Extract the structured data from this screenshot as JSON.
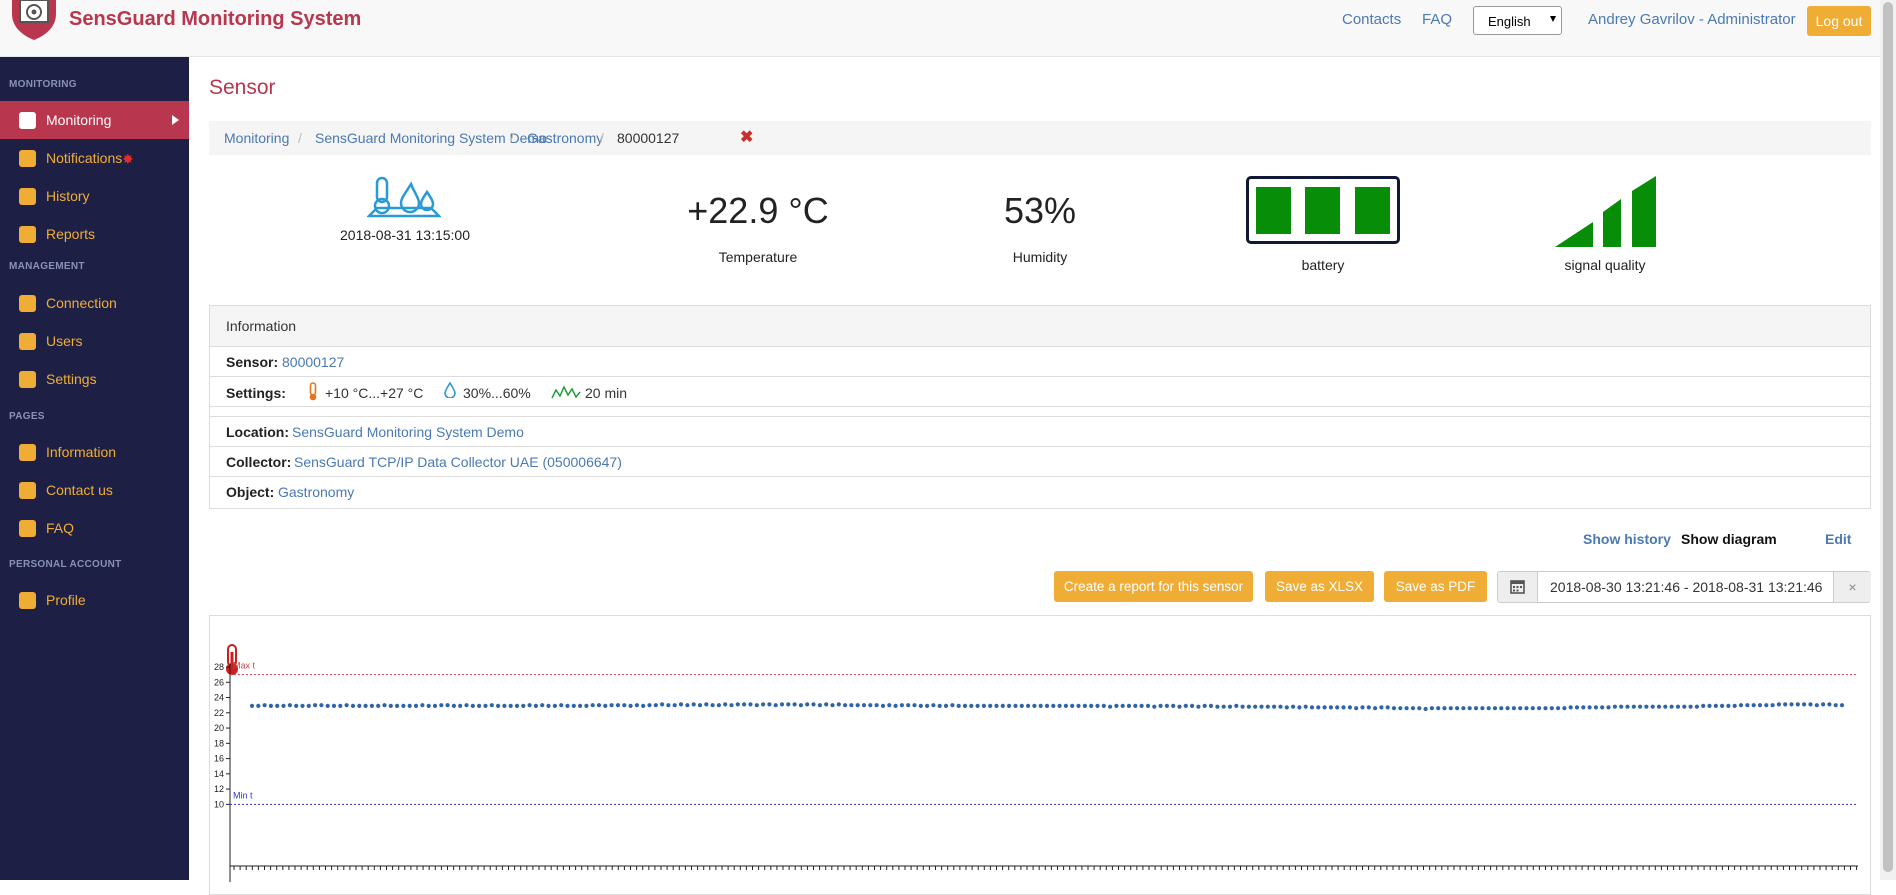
{
  "header": {
    "app_title": "SensGuard Monitoring System",
    "contacts": "Contacts",
    "faq": "FAQ",
    "language": "English",
    "user": "Andrey Gavrilov - Administrator",
    "logout": "Log out"
  },
  "sidebar": {
    "monitoring_head": "MONITORING",
    "management_head": "MANAGEMENT",
    "pages_head": "PAGES",
    "personal_head": "PERSONAL ACCOUNT",
    "items": {
      "monitoring": "Monitoring",
      "notifications": "Notifications",
      "history": "History",
      "reports": "Reports",
      "connection": "Connection",
      "users": "Users",
      "settings": "Settings",
      "information": "Information",
      "contact_us": "Contact us",
      "faq": "FAQ",
      "profile": "Profile"
    },
    "active_color": "#b8374f",
    "accent_color": "#f0ad36"
  },
  "page": {
    "title": "Sensor",
    "breadcrumb": [
      "Monitoring",
      "SensGuard Monitoring System Demo",
      "Gastronomy",
      "80000127"
    ]
  },
  "stats": {
    "timestamp": "2018-08-31 13:15:00",
    "temperature": "+22.9 °C",
    "temperature_label": "Temperature",
    "humidity": "53%",
    "humidity_label": "Humidity",
    "battery_label": "battery",
    "battery_bars": 3,
    "signal_label": "signal quality",
    "signal_bars": 3
  },
  "info": {
    "heading": "Information",
    "sensor_label": "Sensor:",
    "sensor_value": "80000127",
    "settings_label": "Settings:",
    "temp_range": "+10 °C...+27 °C",
    "hum_range": "30%...60%",
    "interval": "20 min",
    "location_label": "Location:",
    "location_value": "SensGuard Monitoring System Demo",
    "collector_label": "Collector:",
    "collector_value": "SensGuard TCP/IP Data Collector UAE (050006647)",
    "object_label": "Object:",
    "object_value": "Gastronomy"
  },
  "actions": {
    "show_history": "Show history",
    "show_diagram": "Show diagram",
    "edit": "Edit",
    "create_report": "Create a report for this sensor",
    "save_xlsx": "Save as XLSX",
    "save_pdf": "Save as PDF",
    "date_range": "2018-08-30 13:21:46 - 2018-08-31 13:21:46",
    "clear": "×"
  },
  "chart_data": {
    "type": "line",
    "max_label": "Max t",
    "min_label": "Min t",
    "max_threshold": 27,
    "min_threshold": 10,
    "ylim": [
      9,
      28
    ],
    "yticks": [
      10,
      12,
      14,
      16,
      18,
      20,
      22,
      24,
      26,
      28
    ],
    "series": [
      {
        "values": [
          22.9,
          22.9,
          23.0,
          22.9,
          22.9,
          22.9,
          23.0,
          22.9,
          22.9,
          22.9,
          23.0,
          23.0,
          22.9,
          22.9,
          22.9,
          23.0,
          22.9,
          22.9,
          22.9,
          22.9,
          22.9,
          23.0,
          22.9,
          22.9,
          22.9,
          22.9,
          22.9,
          23.0,
          22.9,
          22.9,
          23.0,
          23.0,
          22.9,
          22.9,
          23.0,
          22.9,
          22.9,
          22.9,
          23.0,
          22.9,
          22.9,
          22.9,
          22.9,
          22.9,
          23.0,
          22.9,
          23.0,
          22.9,
          22.9,
          23.0,
          22.9,
          22.9,
          22.9,
          22.9,
          23.0,
          23.0,
          22.9,
          23.0,
          23.0,
          23.0,
          22.9,
          23.0,
          22.9,
          23.0,
          23.0,
          23.1,
          23.0,
          23.0,
          23.1,
          23.0,
          23.1,
          23.0,
          23.1,
          23.0,
          23.0,
          23.1,
          23.0,
          23.1,
          23.1,
          23.1,
          23.0,
          23.1,
          23.1,
          23.0,
          23.1,
          23.1,
          23.1,
          23.0,
          23.1,
          23.1,
          23.0,
          23.1,
          23.0,
          23.1,
          23.0,
          23.0,
          23.0,
          23.0,
          23.0,
          23.0,
          22.9,
          23.0,
          22.9,
          23.0,
          23.0,
          23.0,
          22.9,
          22.9,
          23.0,
          22.9,
          22.9,
          23.0,
          22.9,
          22.9,
          22.9,
          22.9,
          22.9,
          22.9,
          22.9,
          22.9,
          22.9,
          22.9,
          22.9,
          22.9,
          22.9,
          22.9,
          22.9,
          22.9,
          22.9,
          22.9,
          22.9,
          22.9,
          22.9,
          22.9,
          22.9,
          22.9,
          22.8,
          22.9,
          22.9,
          22.9,
          22.9,
          22.9,
          22.9,
          22.8,
          22.9,
          22.9,
          22.9,
          22.8,
          22.9,
          22.9,
          22.8,
          22.9,
          22.9,
          22.8,
          22.8,
          22.8,
          22.9,
          22.8,
          22.8,
          22.8,
          22.8,
          22.8,
          22.8,
          22.8,
          22.7,
          22.8,
          22.7,
          22.8,
          22.7,
          22.7,
          22.7,
          22.7,
          22.7,
          22.7,
          22.7,
          22.6,
          22.7,
          22.7,
          22.6,
          22.7,
          22.7,
          22.6,
          22.6,
          22.6,
          22.6,
          22.6,
          22.5,
          22.6,
          22.6,
          22.6,
          22.6,
          22.6,
          22.6,
          22.6,
          22.6,
          22.6,
          22.6,
          22.6,
          22.6,
          22.6,
          22.6,
          22.6,
          22.6,
          22.6,
          22.6,
          22.6,
          22.6,
          22.6,
          22.6,
          22.7,
          22.7,
          22.7,
          22.7,
          22.7,
          22.7,
          22.7,
          22.8,
          22.8,
          22.8,
          22.8,
          22.8,
          22.8,
          22.8,
          22.8,
          22.8,
          22.8,
          22.8,
          22.8,
          22.8,
          22.8,
          22.9,
          22.9,
          22.9,
          22.9,
          22.9,
          22.9,
          23.0,
          23.0,
          23.0,
          23.0,
          23.0,
          23.0,
          23.1,
          23.1,
          23.1,
          23.1,
          23.1,
          23.1,
          23.0,
          23.1,
          23.1,
          23.0,
          23.0
        ]
      }
    ]
  }
}
